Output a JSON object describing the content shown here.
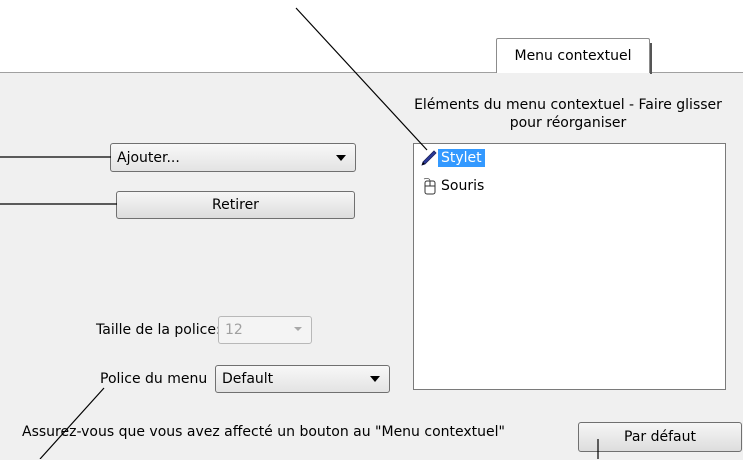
{
  "tab": {
    "label": "Menu contextuel"
  },
  "list": {
    "header": "Eléments du menu contextuel - Faire glisser pour réorganiser",
    "items": [
      {
        "label": "Stylet",
        "icon": "pen-icon",
        "selected": true
      },
      {
        "label": "Souris",
        "icon": "mouse-icon",
        "selected": false
      }
    ]
  },
  "add_combo": {
    "value": "Ajouter..."
  },
  "remove_button": {
    "label": "Retirer"
  },
  "font_size": {
    "label": "Taille de la police:",
    "value": "12"
  },
  "menu_font": {
    "label": "Police du menu",
    "value": "Default"
  },
  "note": "Assurez-vous que vous avez affecté un bouton au \"Menu contextuel\"",
  "default_button": {
    "label": "Par défaut"
  },
  "colors": {
    "selection": "#3399ff",
    "panel": "#f0f0f0"
  }
}
